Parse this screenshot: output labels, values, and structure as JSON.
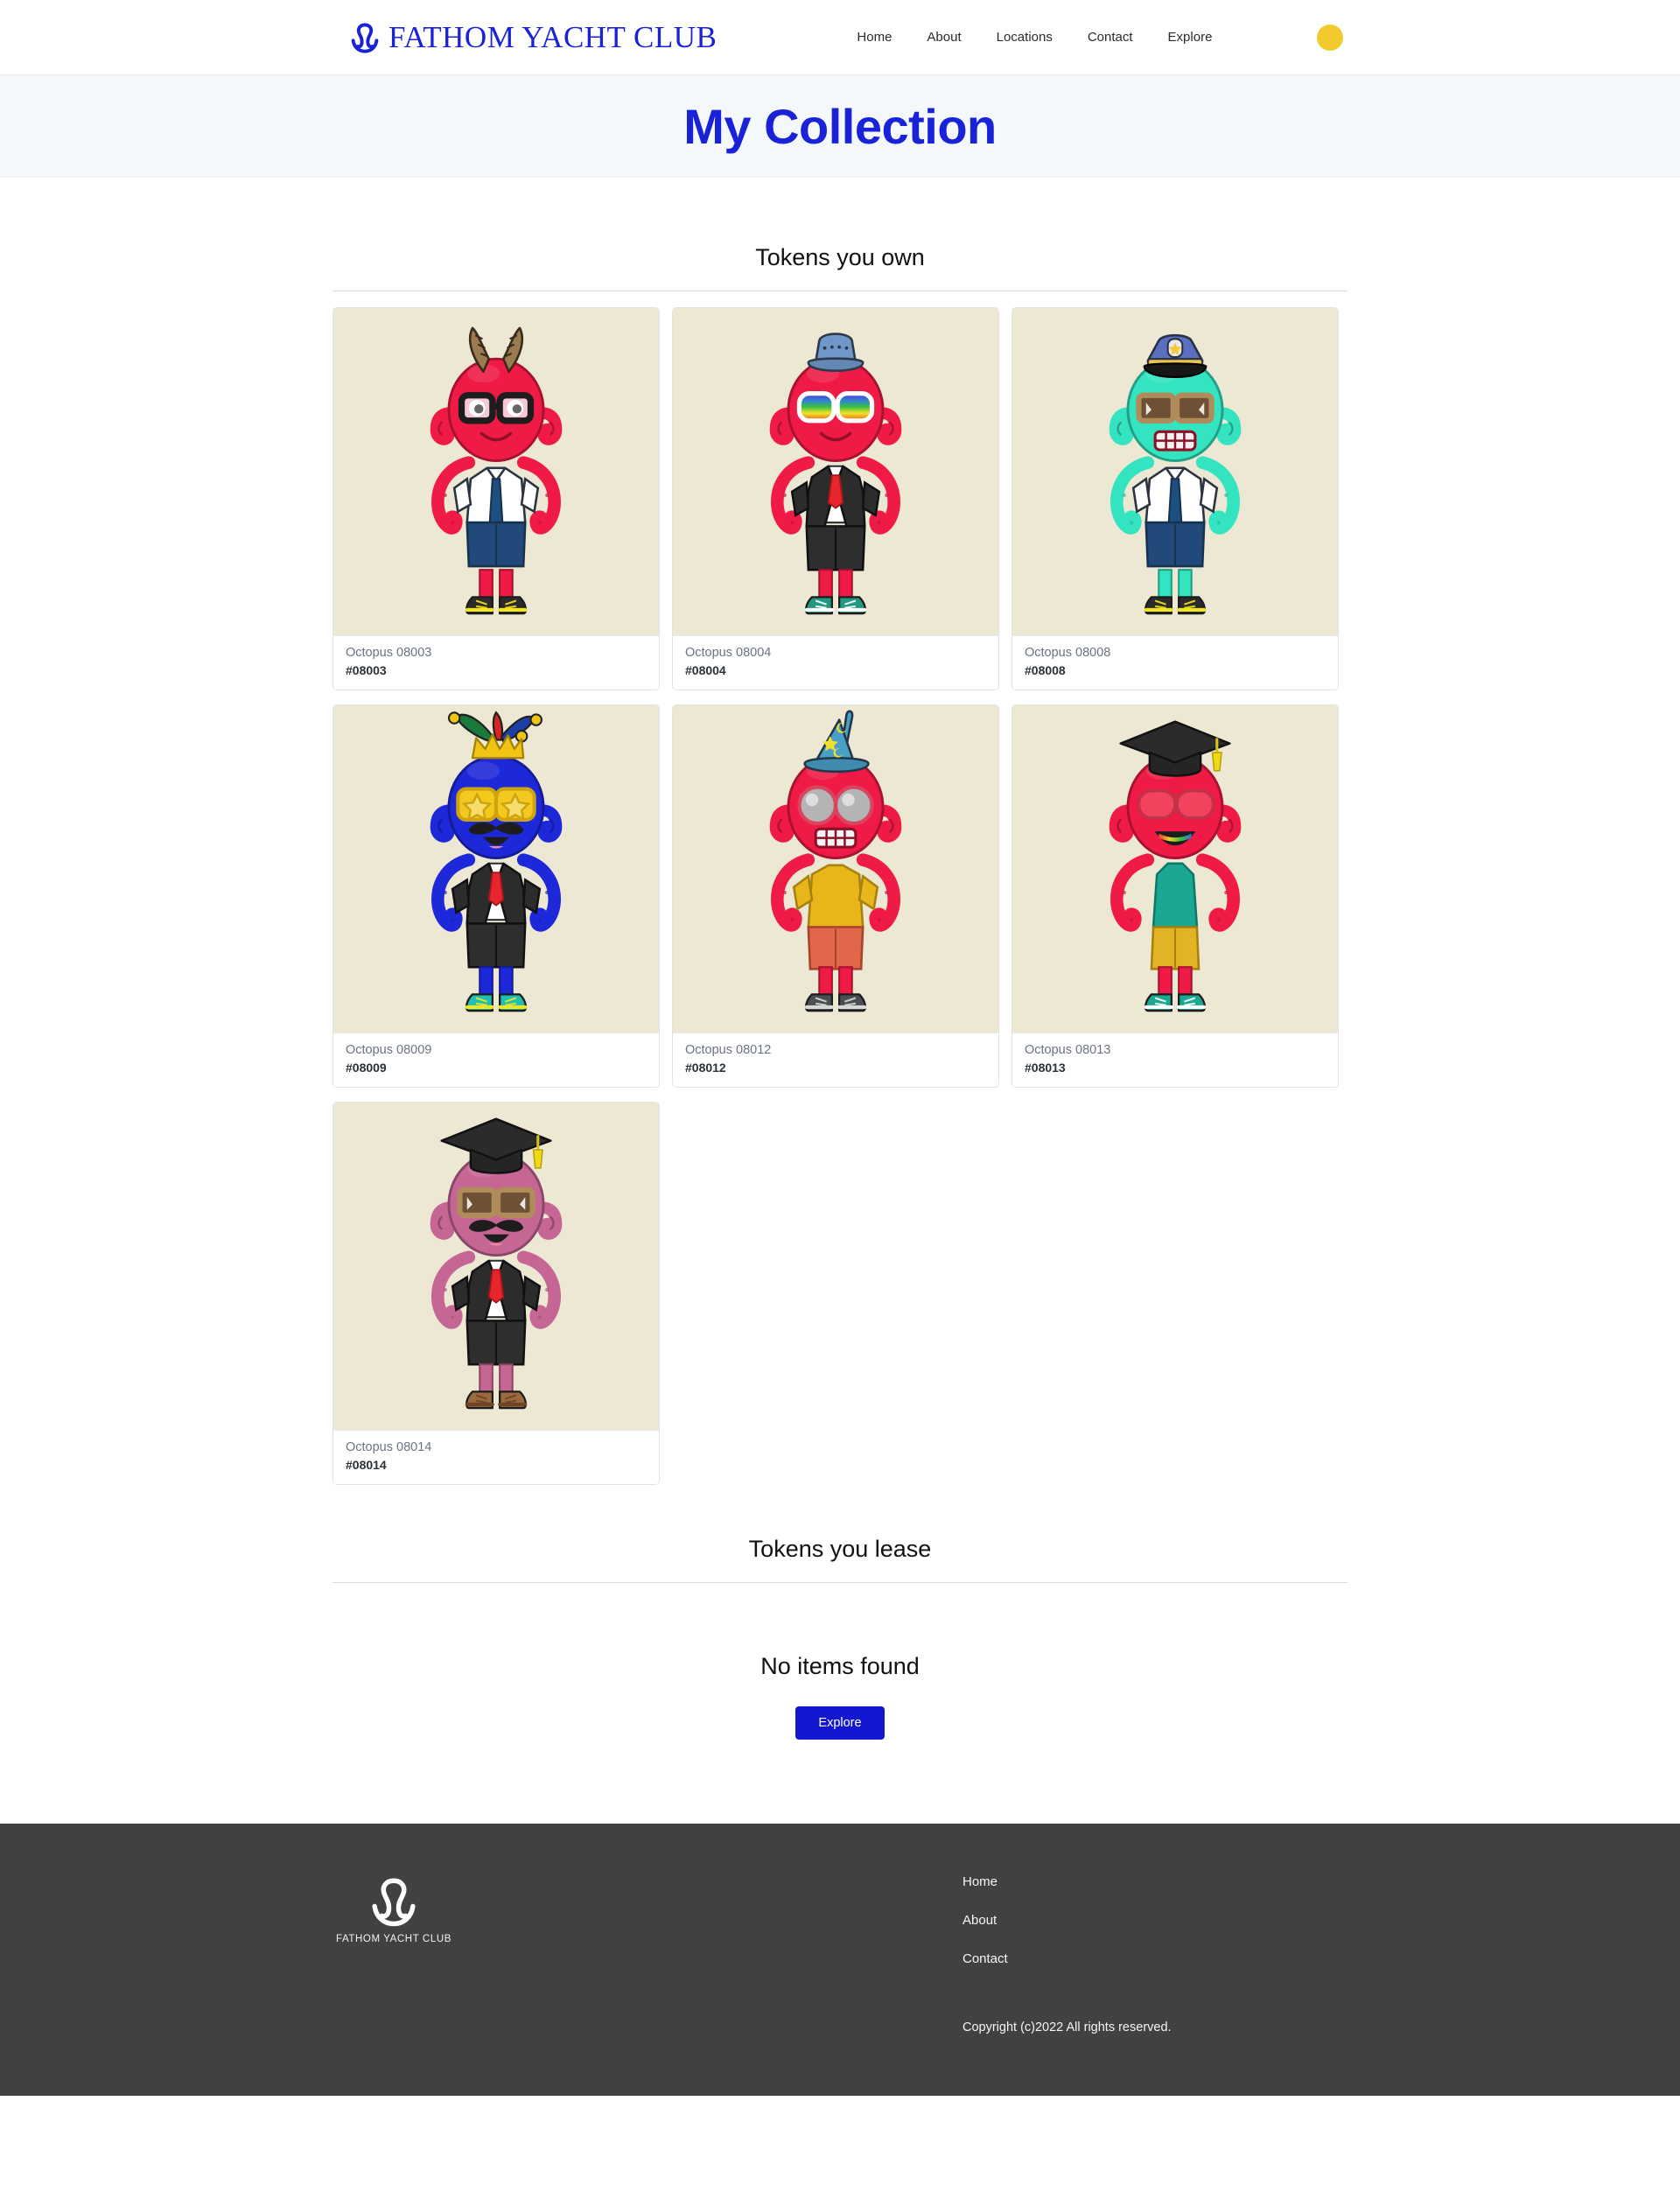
{
  "nav": {
    "brand": "FATHOM YACHT CLUB",
    "brand_icon": "octopus-anchor-logo-icon",
    "brand_color": "#1a22d8",
    "links": [
      {
        "label": "Home"
      },
      {
        "label": "About"
      },
      {
        "label": "Locations"
      },
      {
        "label": "Contact"
      },
      {
        "label": "Explore"
      }
    ],
    "avatar_color": "#f2ca2e"
  },
  "hero": {
    "title": "My Collection",
    "title_color": "#1a22d8",
    "bg_color": "#f4f8fb"
  },
  "owned": {
    "heading": "Tokens you own",
    "cards": [
      {
        "name": "Octopus 08003",
        "id": "#08003",
        "art": {
          "body": "#ef1a46",
          "tentacle": "#ef1a46",
          "hat": "horns",
          "hat_color": "#9b7b52",
          "glasses": "nerd-black",
          "lens": "#f6c8d4",
          "mouth": "smile",
          "outfit": "white-shirt-navy-tie",
          "shirt": "#ffffff",
          "tie": "#1d4f80",
          "pants": "#214a7a",
          "shoes": "black-yellow",
          "shoe": "#2b2b2b",
          "shoe_accent": "#f4e61c"
        }
      },
      {
        "name": "Octopus 08004",
        "id": "#08004",
        "art": {
          "body": "#ef1a46",
          "tentacle": "#ef1a46",
          "hat": "bucket-hat",
          "hat_color": "#6f97c7",
          "glasses": "rainbow-shades",
          "lens": "rainbow",
          "mouth": "smile",
          "outfit": "black-suit-red-tie",
          "shirt": "#ffffff",
          "tie": "#e8252c",
          "pants": "#2e2e2e",
          "shoes": "teal-sneakers",
          "shoe": "#22997f",
          "shoe_accent": "#ffffff"
        }
      },
      {
        "name": "Octopus 08008",
        "id": "#08008",
        "art": {
          "body": "#34e3c0",
          "tentacle": "#34e3c0",
          "hat": "police-cap",
          "hat_color": "#5b6fc0",
          "glasses": "brown-square",
          "lens": "#6e5134",
          "mouth": "grit-teeth",
          "outfit": "white-shirt-navy-tie",
          "shirt": "#ffffff",
          "tie": "#1d4f80",
          "pants": "#214a7a",
          "shoes": "black-yellow",
          "shoe": "#2b2b2b",
          "shoe_accent": "#f4e61c"
        }
      },
      {
        "name": "Octopus 08009",
        "id": "#08009",
        "art": {
          "body": "#1d28d8",
          "tentacle": "#1d28d8",
          "hat": "jester-crown",
          "hat_color": "#f0c414",
          "glasses": "star-shades",
          "lens": "#f6cf3c",
          "mouth": "mustache-open",
          "outfit": "black-suit-red-tie",
          "shirt": "#ffffff",
          "tie": "#e8252c",
          "pants": "#2e2e2e",
          "shoes": "teal-yellow",
          "shoe": "#1fbfb5",
          "shoe_accent": "#f4e61c"
        }
      },
      {
        "name": "Octopus 08012",
        "id": "#08012",
        "art": {
          "body": "#ef1a46",
          "tentacle": "#ef1a46",
          "hat": "wizard-hat",
          "hat_color": "#4a9fc6",
          "glasses": "round-goggles",
          "lens": "#9a9a9a",
          "mouth": "grit-teeth",
          "outfit": "yellow-tee",
          "shirt": "#e8b618",
          "tie": "none",
          "pants": "#e0674a",
          "shoes": "dark-slip-on",
          "shoe": "#4a4f52",
          "shoe_accent": "#d8d8d8"
        }
      },
      {
        "name": "Octopus 08013",
        "id": "#08013",
        "art": {
          "body": "#ef1a46",
          "tentacle": "#ef1a46",
          "hat": "graduation-cap",
          "hat_color": "#2b2b2b",
          "glasses": "red-aviator",
          "lens": "#f2435e",
          "mouth": "rainbow-open",
          "outfit": "teal-tank",
          "shirt": "#1ba893",
          "tie": "none",
          "pants": "#e0b425",
          "shoes": "teal-hightops",
          "shoe": "#1ba893",
          "shoe_accent": "#ffffff"
        }
      },
      {
        "name": "Octopus 08014",
        "id": "#08014",
        "art": {
          "body": "#c56694",
          "tentacle": "#c56694",
          "hat": "graduation-cap",
          "hat_color": "#2b2b2b",
          "glasses": "brown-square",
          "lens": "#6e5134",
          "mouth": "mustache-open",
          "outfit": "black-suit-red-tie",
          "shirt": "#ffffff",
          "tie": "#e8252c",
          "pants": "#2e2e2e",
          "shoes": "brown-boots",
          "shoe": "#9b6a3f",
          "shoe_accent": "#6b4526"
        }
      }
    ]
  },
  "leased": {
    "heading": "Tokens you lease",
    "empty_message": "No items found",
    "explore_label": "Explore",
    "explore_color": "#1218d0"
  },
  "footer": {
    "brand": "FATHOM YACHT CLUB",
    "brand_icon": "octopus-anchor-logo-icon",
    "links": [
      {
        "label": "Home"
      },
      {
        "label": "About"
      },
      {
        "label": "Contact"
      }
    ],
    "copyright": "Copyright (c)2022 All rights reserved.",
    "bg_color": "#414141"
  }
}
